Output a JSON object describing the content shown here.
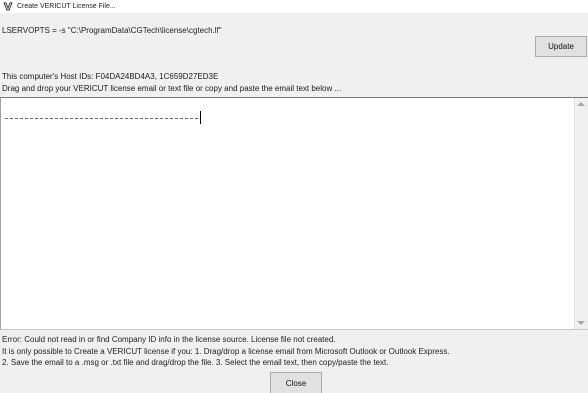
{
  "window": {
    "title": "Create VERICUT License File..."
  },
  "license": {
    "lservopts": "LSERVOPTS = -s \"C:\\ProgramData\\CGTech\\license\\cgtech.lf\"",
    "update_label": "Update",
    "host_ids": "This computer's Host IDs: F04DA24BD4A3, 1C659D27ED3E",
    "drag_instructions": "Drag and drop your VERICUT license email or text file or copy and paste the email text below ...",
    "email_text": ""
  },
  "messages": {
    "error": "Error: Could not read in or find Company ID info in the license source. License file not created.",
    "line2": "It is only possible to Create a VERICUT license if you: 1. Drag/drop a license email from Microsoft Outlook or Outlook Express.",
    "line3": "2. Save the email to a .msg or .txt file and drag/drop the file. 3. Select the email text, then copy/paste the text."
  },
  "footer": {
    "close_label": "Close"
  },
  "icons": {
    "app": "vericut-app-icon"
  }
}
